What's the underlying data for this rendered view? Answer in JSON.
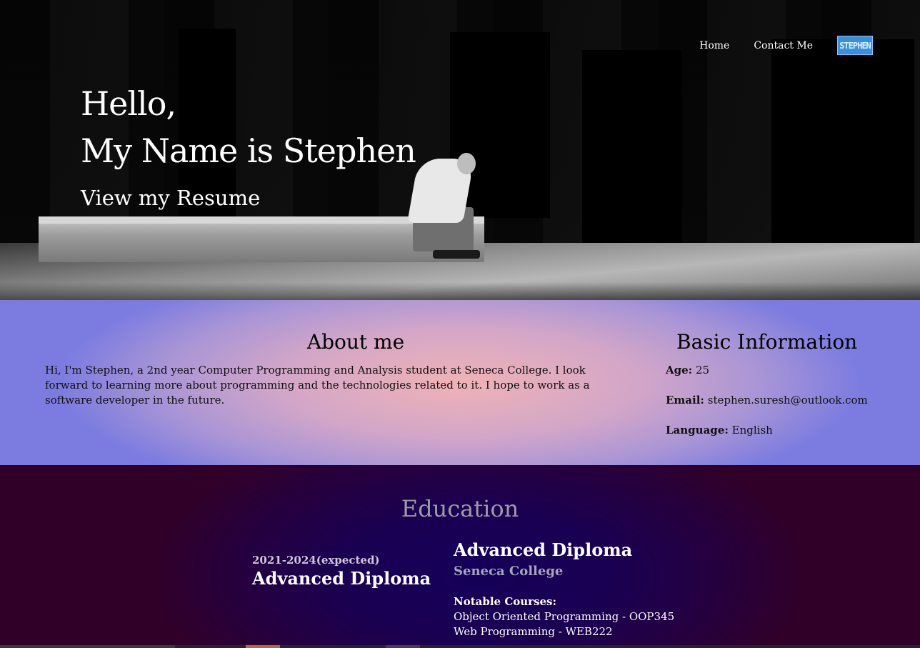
{
  "nav": {
    "items": [
      {
        "label": "Home"
      },
      {
        "label": "Contact Me"
      }
    ],
    "logo_text": "STEPHEN"
  },
  "hero": {
    "line1": "Hello,",
    "line2": "My Name is Stephen",
    "resume_link": "View my Resume"
  },
  "about": {
    "title": "About me",
    "text": "Hi, I'm Stephen, a 2nd year Computer Programming and Analysis student at Seneca College. I look forward to learning more about programming and the technologies related to it. I hope to work as a software developer in the future."
  },
  "basic_info": {
    "title": "Basic Information",
    "fields": [
      {
        "label": "Age:",
        "value": "25"
      },
      {
        "label": "Email:",
        "value": "stephen.suresh@outlook.com"
      },
      {
        "label": "Language:",
        "value": "English"
      }
    ]
  },
  "education": {
    "title": "Education",
    "dates": "2021-2024(expected)",
    "degree_left": "Advanced Diploma",
    "degree_right": "Advanced Diploma",
    "school": "Seneca College",
    "courses_label": "Notable Courses:",
    "courses": [
      "Object Oriented Programming - OOP345",
      "Web Programming - WEB222"
    ]
  },
  "colors": {
    "logo_bg": "#3a8fd6",
    "about_center": "#f0b2b6",
    "about_edge": "#7c7ce0",
    "education_center": "#14005a",
    "education_edge": "#300028"
  },
  "icons": [
    "logo-icon"
  ]
}
